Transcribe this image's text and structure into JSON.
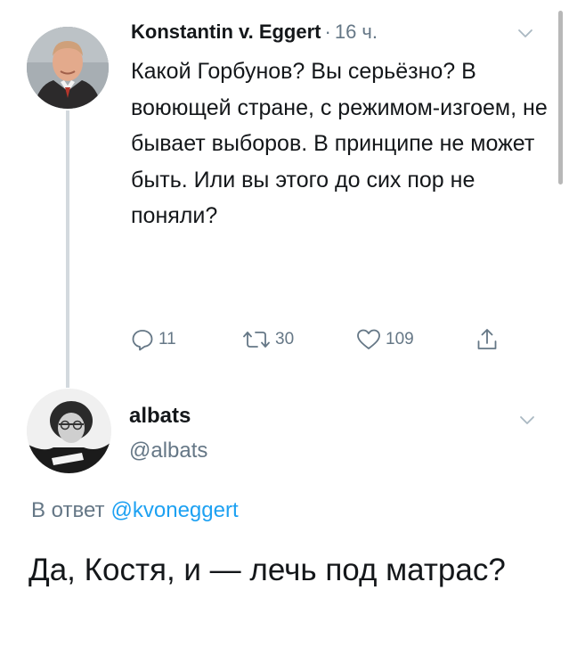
{
  "tweet1": {
    "author_name": "Konstantin v. Eggert",
    "separator": "·",
    "time": "16 ч.",
    "avatar_icon": "user-photo-icon",
    "text": "Какой Горбунов? Вы серьёзно? В воюющей стране, с режимом-изгоем, не бывает выборов. В принципе не может быть. Или вы этого до сих пор не поняли?",
    "actions": {
      "reply_count": "11",
      "retweet_count": "30",
      "like_count": "109"
    }
  },
  "tweet2": {
    "author_name": "albats",
    "handle": "@albats",
    "avatar_icon": "user-photo-icon",
    "reply_prefix": "В ответ",
    "reply_mention": "@kvoneggert",
    "text": "Да, Костя, и — лечь под матрас?"
  },
  "colors": {
    "text": "#14171a",
    "secondary": "#657786",
    "link": "#1da1f2",
    "thread_line": "#d3d9de"
  }
}
